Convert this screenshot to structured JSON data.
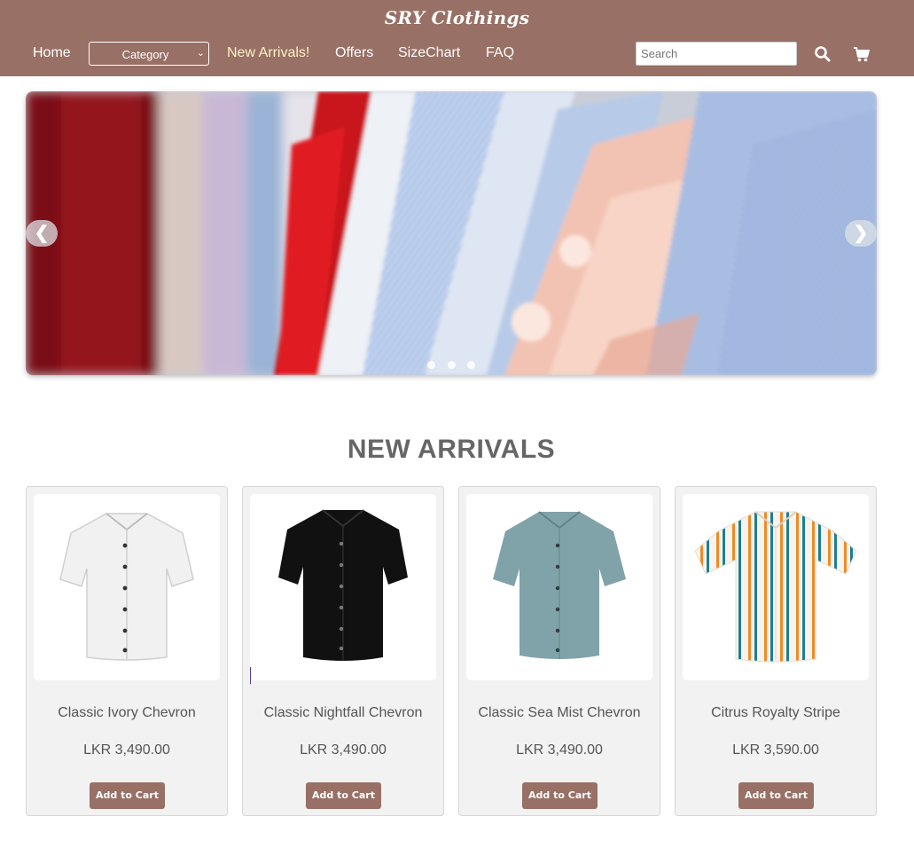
{
  "brand": "SRY Clothings",
  "nav": {
    "home": "Home",
    "category": "Category",
    "new_arrivals": "New Arrivals!",
    "offers": "Offers",
    "sizechart": "SizeChart",
    "faq": "FAQ"
  },
  "search": {
    "placeholder": "Search",
    "value": ""
  },
  "icons": {
    "search": "search-icon",
    "cart": "cart-icon",
    "prev": "chevron-left-icon",
    "next": "chevron-right-icon"
  },
  "carousel": {
    "prev_label": "❮",
    "next_label": "❯",
    "slide_count": 3,
    "active_index": 2
  },
  "section_title": "NEW ARRIVALS",
  "products": [
    {
      "name": "Classic Ivory Chevron",
      "price": "LKR 3,490.00",
      "button": "Add to Cart",
      "shirt_color": "#f2f2f2"
    },
    {
      "name": "Classic Nightfall Chevron",
      "price": "LKR 3,490.00",
      "button": "Add to Cart",
      "shirt_color": "#111111"
    },
    {
      "name": "Classic Sea Mist Chevron",
      "price": "LKR 3,490.00",
      "button": "Add to Cart",
      "shirt_color": "#7fa3a8"
    },
    {
      "name": "Citrus Royalty Stripe",
      "price": "LKR 3,590.00",
      "button": "Add to Cart",
      "shirt_color": "#f7f4ee"
    }
  ],
  "colors": {
    "header": "#987065",
    "accent_link": "#fff1c6",
    "button": "#987065"
  }
}
